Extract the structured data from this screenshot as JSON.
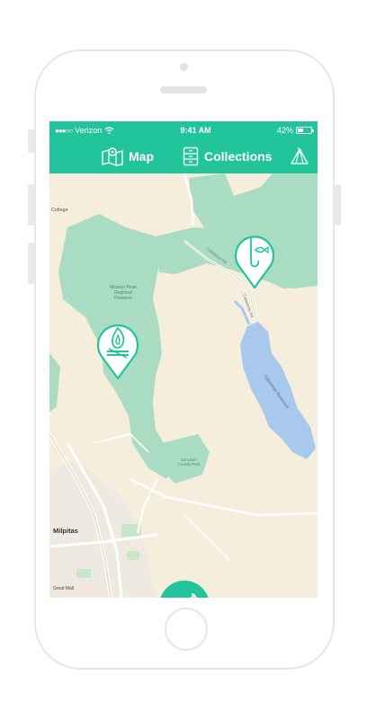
{
  "status": {
    "carrier": "Verizon",
    "signal_dots": "●●●○○",
    "time": "9:41 AM",
    "battery": "42%",
    "battery_level": 0.42
  },
  "nav": {
    "map_label": "Map",
    "collections_label": "Collections",
    "map_icon": "map-icon",
    "collections_icon": "collections-icon",
    "camp_icon": "tent-icon"
  },
  "map": {
    "labels": {
      "college": "College",
      "preserve": "Mission Peak Regional Preserve",
      "reservoir": "Calaveras Reservoir",
      "park": "Ed Levin County Park",
      "city": "Milpitas",
      "mall": "Great Mall",
      "road1": "Calaveras Rd",
      "road2": "Calaveras Rd"
    },
    "pins": [
      {
        "kind": "fishing-spot",
        "icon": "fishing-hook-icon"
      },
      {
        "kind": "campfire-spot",
        "icon": "campfire-icon"
      }
    ]
  },
  "fab": {
    "icon": "shovel-icon"
  },
  "colors": {
    "accent": "#22c49b",
    "park_green": "#a9dcc2",
    "land": "#f5eedd",
    "water": "#a8c8ec"
  }
}
